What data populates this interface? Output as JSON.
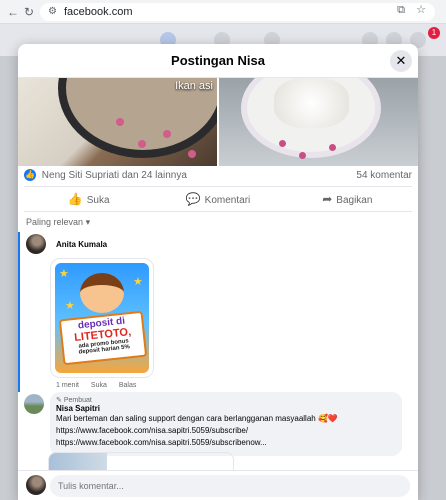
{
  "browser": {
    "url": "facebook.com",
    "icons": [
      "back-icon",
      "reload-icon",
      "site-info-icon",
      "install-app-icon",
      "bookmark-star-icon"
    ]
  },
  "fb_header": {
    "notification_count": "1"
  },
  "modal": {
    "title": "Postingan Nisa",
    "close_icon": "close-icon"
  },
  "photos": {
    "caption": "Ikan asi"
  },
  "stats": {
    "reactions": "Neng Siti Supriati dan 24 lainnya",
    "comments": "54 komentar"
  },
  "actions": {
    "like": "Suka",
    "comment": "Komentari",
    "share": "Bagikan"
  },
  "sort": {
    "label": "Paling relevan"
  },
  "comment1": {
    "author": "Anita Kumala",
    "sticker": {
      "line1": "deposit di",
      "line2": "LITETOTO,",
      "line3": "ada promo bonus",
      "line4": "deposit harian 5%"
    },
    "time": "1 menit",
    "like": "Suka",
    "reply": "Balas"
  },
  "comment2": {
    "badge": "Pembuat",
    "author": "Nisa Sapitri",
    "text": "Mari berteman dan saling support dengan cara berlangganan masyaallah 🥰❤️",
    "link1": "https://www.facebook.com/nisa.sapitri.5059/subscribe/",
    "link2": "https://www.facebook.com/nisa.sapitri.5059/subscribenow..."
  },
  "composer": {
    "placeholder": "Tulis komentar..."
  },
  "colors": {
    "accent": "#1877f2",
    "brand_bg": "#e4e6eb"
  }
}
